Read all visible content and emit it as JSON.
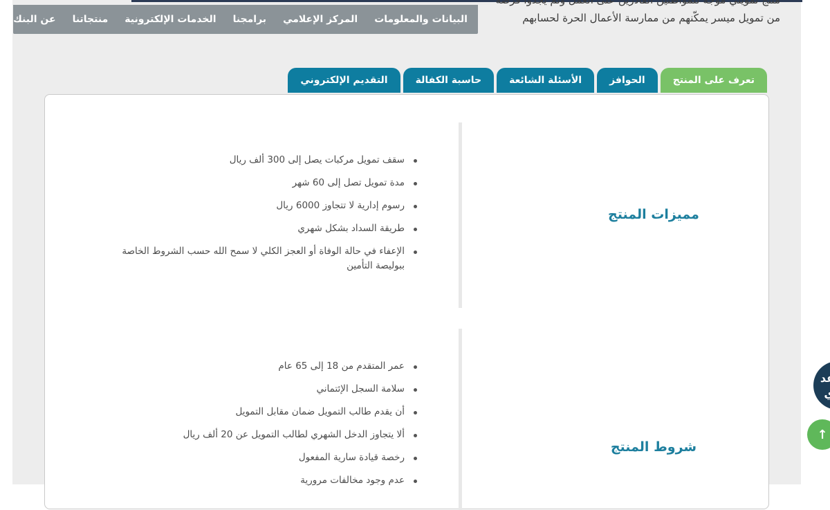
{
  "intro": {
    "line1": "منتج تمويلي موجه للمواطنين القادرين على العمل ولم يجدوا فرصة",
    "line2": "من تمويل ميسر يمكّنهم من ممارسة الأعمال الحرة لحسابهم"
  },
  "nav": {
    "items": [
      {
        "label": "عن البنك"
      },
      {
        "label": "منتجاتنا"
      },
      {
        "label": "الخدمات الإلكترونية"
      },
      {
        "label": "برامجنا"
      },
      {
        "label": "المركز الإعلامي"
      },
      {
        "label": "البيانات والمعلومات"
      }
    ]
  },
  "tabs": [
    {
      "label": "تعرف على المنتج",
      "active": true
    },
    {
      "label": "الحوافز"
    },
    {
      "label": "الأسئلة الشائعة"
    },
    {
      "label": "حاسبة الكفالة"
    },
    {
      "label": "التقديم الإلكتروني"
    }
  ],
  "features": {
    "title": "مميزات المنتج",
    "items": [
      "سقف تمويل مركبات يصل إلى 300 ألف ريال",
      "مدة تمويل تصل إلى 60 شهر",
      "رسوم إدارية لا تتجاوز 6000 ريال",
      "طريقة السداد بشكل شهري",
      "الإعفاء في حالة الوفاة أو العجز الكلي لا سمح الله حسب الشروط الخاصة ببوليصة التأمين"
    ]
  },
  "conditions": {
    "title": "شروط المنتج",
    "items": [
      "عمر المتقدم من 18 إلى 65 عام",
      "سلامة السجل الإئتماني",
      "أن يقدم طالب التمويل ضمان مقابل التمويل",
      "ألا يتجاوز الدخل الشهري لطالب التمويل عن 20 ألف ريال",
      "رخصة قيادة سارية المفعول",
      "عدم وجود مخالفات مرورية"
    ]
  },
  "widgets": {
    "chat_label": "عد ي",
    "scroll_top_icon": "arrow-up-icon",
    "scroll_top_glyph": "↑"
  },
  "colors": {
    "nav_bg": "#8b9398",
    "tab_bg": "#0e7da0",
    "tab_active_bg": "#79c267",
    "section_title": "#1d7f9e",
    "chat_bg": "#1c3d57",
    "scroll_top_bg": "#5fb85a"
  }
}
